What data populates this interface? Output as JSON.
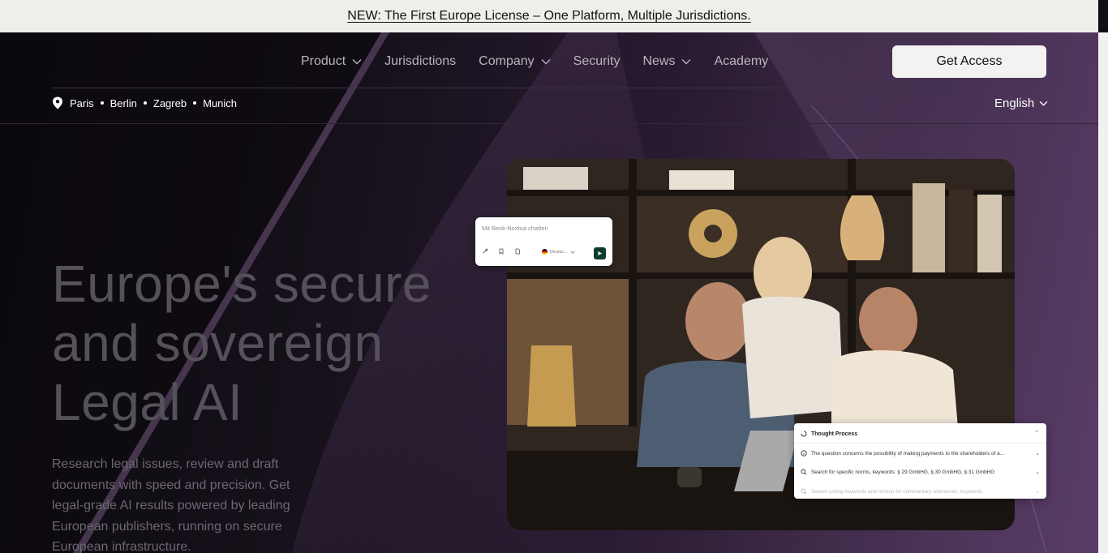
{
  "announcement": {
    "text": "NEW: The First Europe License – One Platform, Multiple Jurisdictions."
  },
  "nav": {
    "items": [
      {
        "label": "Product",
        "dropdown": true
      },
      {
        "label": "Jurisdictions",
        "dropdown": false
      },
      {
        "label": "Company",
        "dropdown": true
      },
      {
        "label": "Security",
        "dropdown": false
      },
      {
        "label": "News",
        "dropdown": true
      },
      {
        "label": "Academy",
        "dropdown": false
      }
    ],
    "cta": "Get Access"
  },
  "locations": {
    "icon": "location-pin-icon",
    "cities": [
      "Paris",
      "Berlin",
      "Zagreb",
      "Munich"
    ]
  },
  "language": {
    "selected": "English"
  },
  "hero": {
    "title_lines": [
      "Europe's secure",
      "and sovereign",
      "Legal AI"
    ],
    "description": "Research legal issues, review and draft documents with speed and precision. Get legal-grade AI results powered by leading European publishers, running on secure European infrastructure."
  },
  "chat_card": {
    "placeholder": "Mit Beck-Noxtua chatten",
    "language": "Deutsc..."
  },
  "thought_process": {
    "title": "Thought Process",
    "rows": [
      "The question concerns the possibility of making payments to the shareholders of a...",
      "Search for specific norms, keywords: § 29 GmbHG, § 30 GmbHG, § 31 GmbHG",
      "Search (using keywords and norms) for commentary references, keywords"
    ]
  },
  "colors": {
    "accent": "#0f3d2c",
    "announce_bg": "#efeeeb",
    "cta_bg": "#f3f2f0"
  }
}
